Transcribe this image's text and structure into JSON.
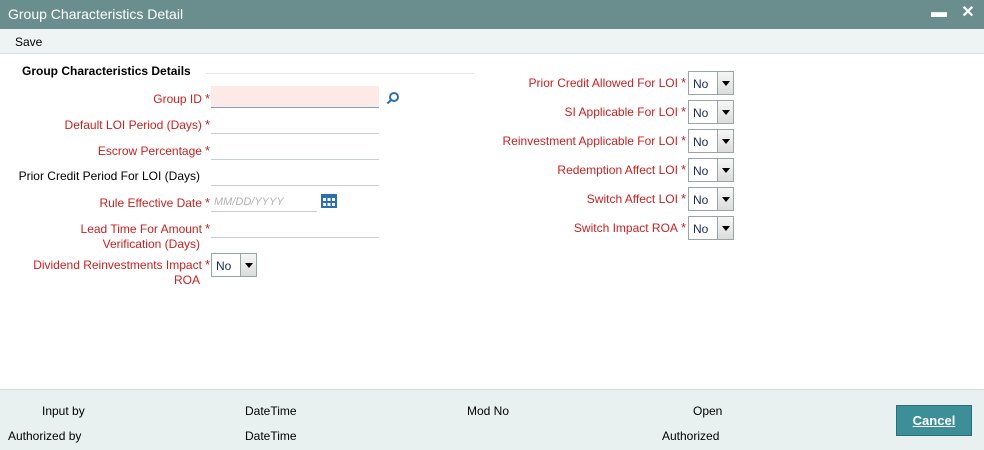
{
  "window": {
    "title": "Group Characteristics Detail"
  },
  "toolbar": {
    "save_label": "Save"
  },
  "section": {
    "title": "Group Characteristics Details"
  },
  "left_fields": {
    "group_id": {
      "label": "Group ID",
      "value": ""
    },
    "default_loi_period": {
      "label": "Default LOI Period (Days)",
      "value": ""
    },
    "escrow_percentage": {
      "label": "Escrow Percentage",
      "value": ""
    },
    "prior_credit_period": {
      "label": "Prior Credit Period For LOI (Days)",
      "value": ""
    },
    "rule_effective_date": {
      "label": "Rule Effective Date",
      "placeholder": "MM/DD/YYYY",
      "value": ""
    },
    "lead_time_line1": "Lead Time For Amount",
    "lead_time_line2": "Verification (Days)",
    "dividend_line1": "Dividend Reinvestments Impact",
    "dividend_line2": "ROA",
    "dividend_value": "No"
  },
  "right_fields": [
    {
      "label": "Prior Credit Allowed For LOI",
      "value": "No"
    },
    {
      "label": "SI Applicable For LOI",
      "value": "No"
    },
    {
      "label": "Reinvestment Applicable For LOI",
      "value": "No"
    },
    {
      "label": "Redemption Affect LOI",
      "value": "No"
    },
    {
      "label": "Switch Affect LOI",
      "value": "No"
    },
    {
      "label": "Switch Impact ROA",
      "value": "No"
    }
  ],
  "required_marker": "*",
  "footer": {
    "input_by": "Input by",
    "authorized_by": "Authorized by",
    "datetime1": "DateTime",
    "datetime2": "DateTime",
    "mod_no": "Mod No",
    "open": "Open",
    "authorized": "Authorized",
    "cancel_label": "Cancel"
  }
}
